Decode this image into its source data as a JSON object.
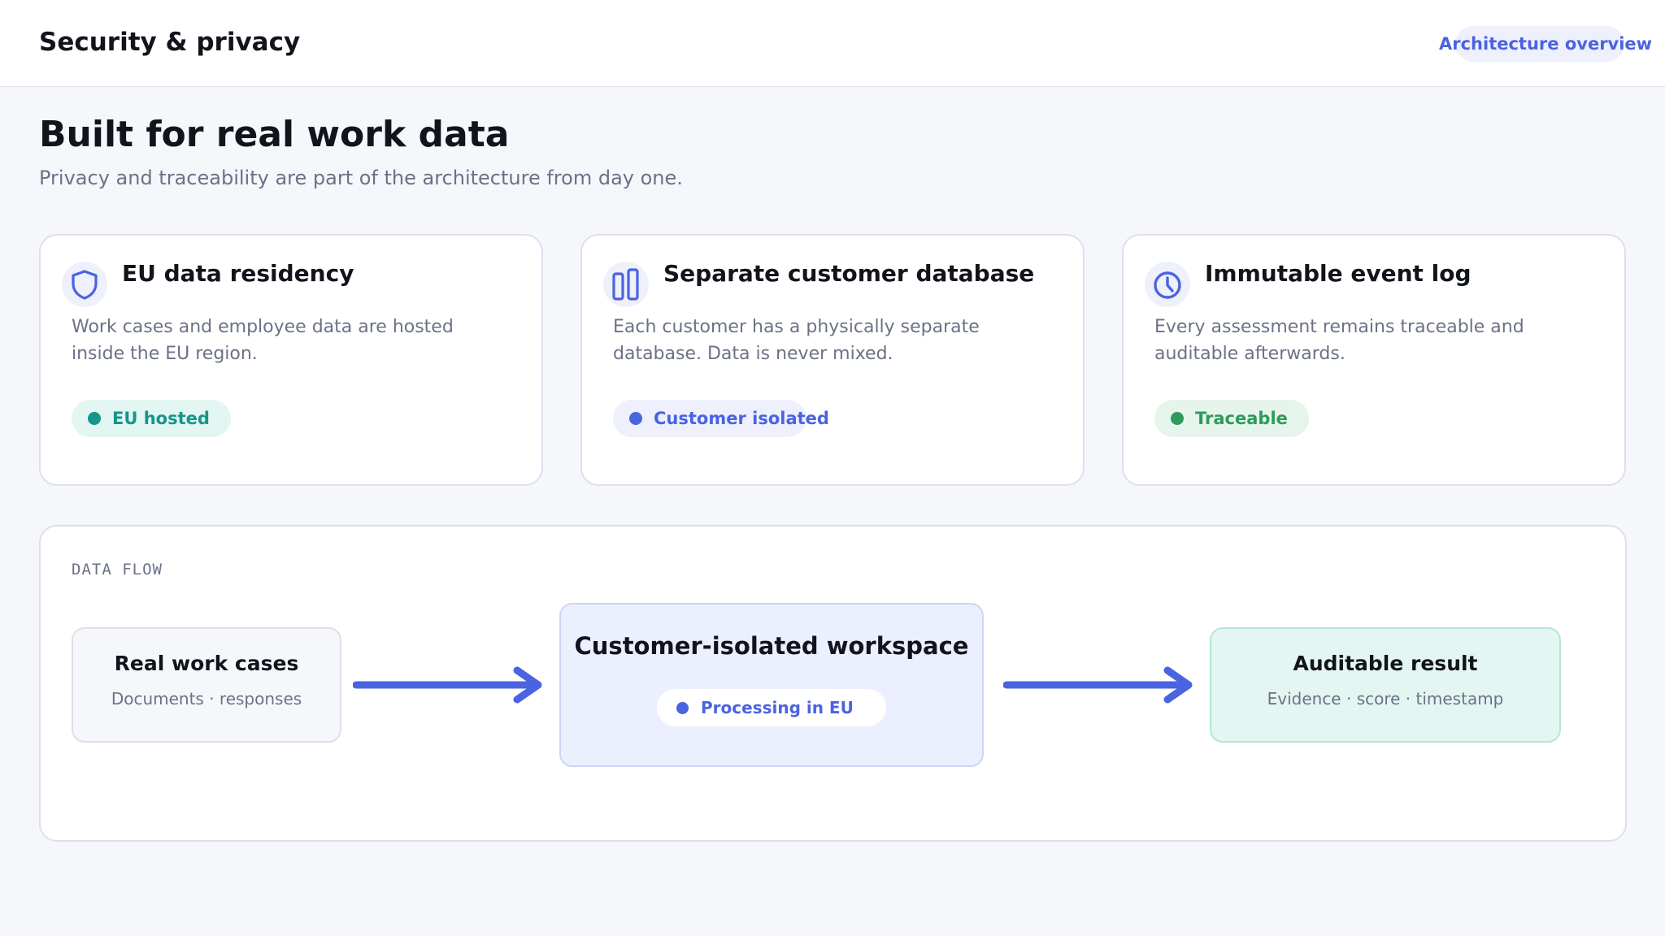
{
  "header": {
    "title": "Security & privacy",
    "action_label": "Architecture overview"
  },
  "hero": {
    "title": "Built for real work data",
    "subtitle": "Privacy and traceability are part of the architecture from day one."
  },
  "features": [
    {
      "icon": "shield-icon",
      "title": "EU data residency",
      "description": "Work cases and employee data are hosted inside the EU region.",
      "badge": "EU hosted",
      "badge_color": "#14968a"
    },
    {
      "icon": "database-columns-icon",
      "title": "Separate customer database",
      "description": "Each customer has a physically separate database. Data is never mixed.",
      "badge": "Customer isolated",
      "badge_color": "#4a63e0"
    },
    {
      "icon": "clock-icon",
      "title": "Immutable event log",
      "description": "Every assessment remains traceable and auditable afterwards.",
      "badge": "Traceable",
      "badge_color": "#2e9a5c"
    }
  ],
  "flow": {
    "label": "DATA FLOW",
    "source": {
      "title": "Real work cases",
      "subtitle": "Documents · responses"
    },
    "workspace": {
      "title": "Customer-isolated workspace",
      "badge": "Processing in EU"
    },
    "result": {
      "title": "Auditable result",
      "subtitle": "Evidence · score · timestamp"
    }
  },
  "colors": {
    "accent": "#4a63e0",
    "teal": "#14968a",
    "green": "#2e9a5c",
    "background": "#f6f7fb"
  }
}
